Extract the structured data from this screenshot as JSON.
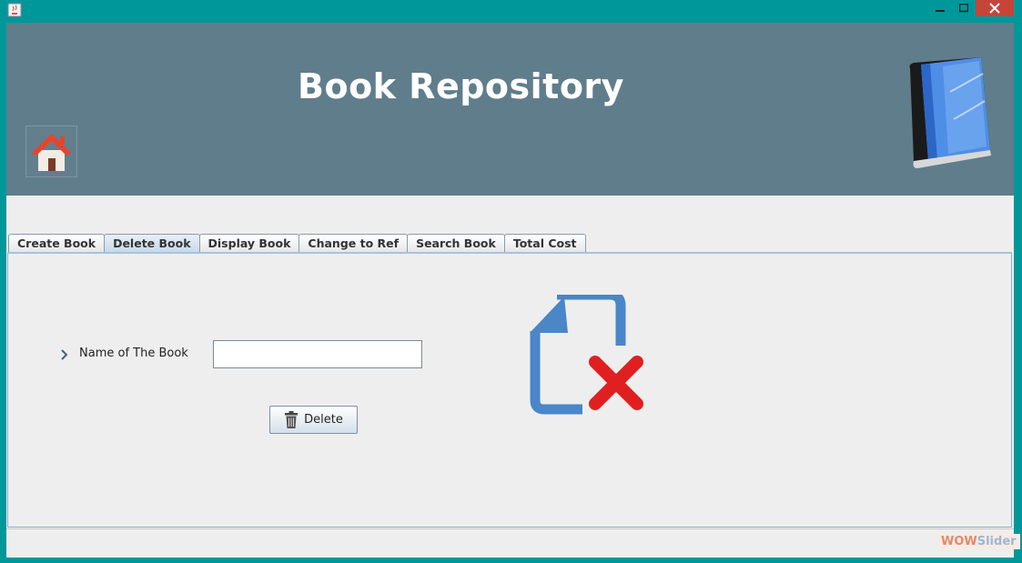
{
  "header": {
    "title": "Book Repository"
  },
  "tabs": [
    {
      "label": "Create Book"
    },
    {
      "label": "Delete Book",
      "active": true
    },
    {
      "label": "Display Book"
    },
    {
      "label": "Change to Ref"
    },
    {
      "label": "Search Book"
    },
    {
      "label": "Total Cost"
    }
  ],
  "form": {
    "name_label": "Name of The Book",
    "name_value": "",
    "delete_label": "Delete"
  },
  "watermark": {
    "part1": "WOW",
    "part2": "Slider"
  },
  "icons": {
    "home": "home-icon",
    "book": "book-icon",
    "trash": "trash-icon",
    "delete_document": "delete-document-icon"
  },
  "colors": {
    "header_bg": "#607d8b",
    "window_border": "#00979a",
    "close_button": "#c7443a",
    "doc_blue": "#4a86c8",
    "x_red": "#e02020"
  }
}
